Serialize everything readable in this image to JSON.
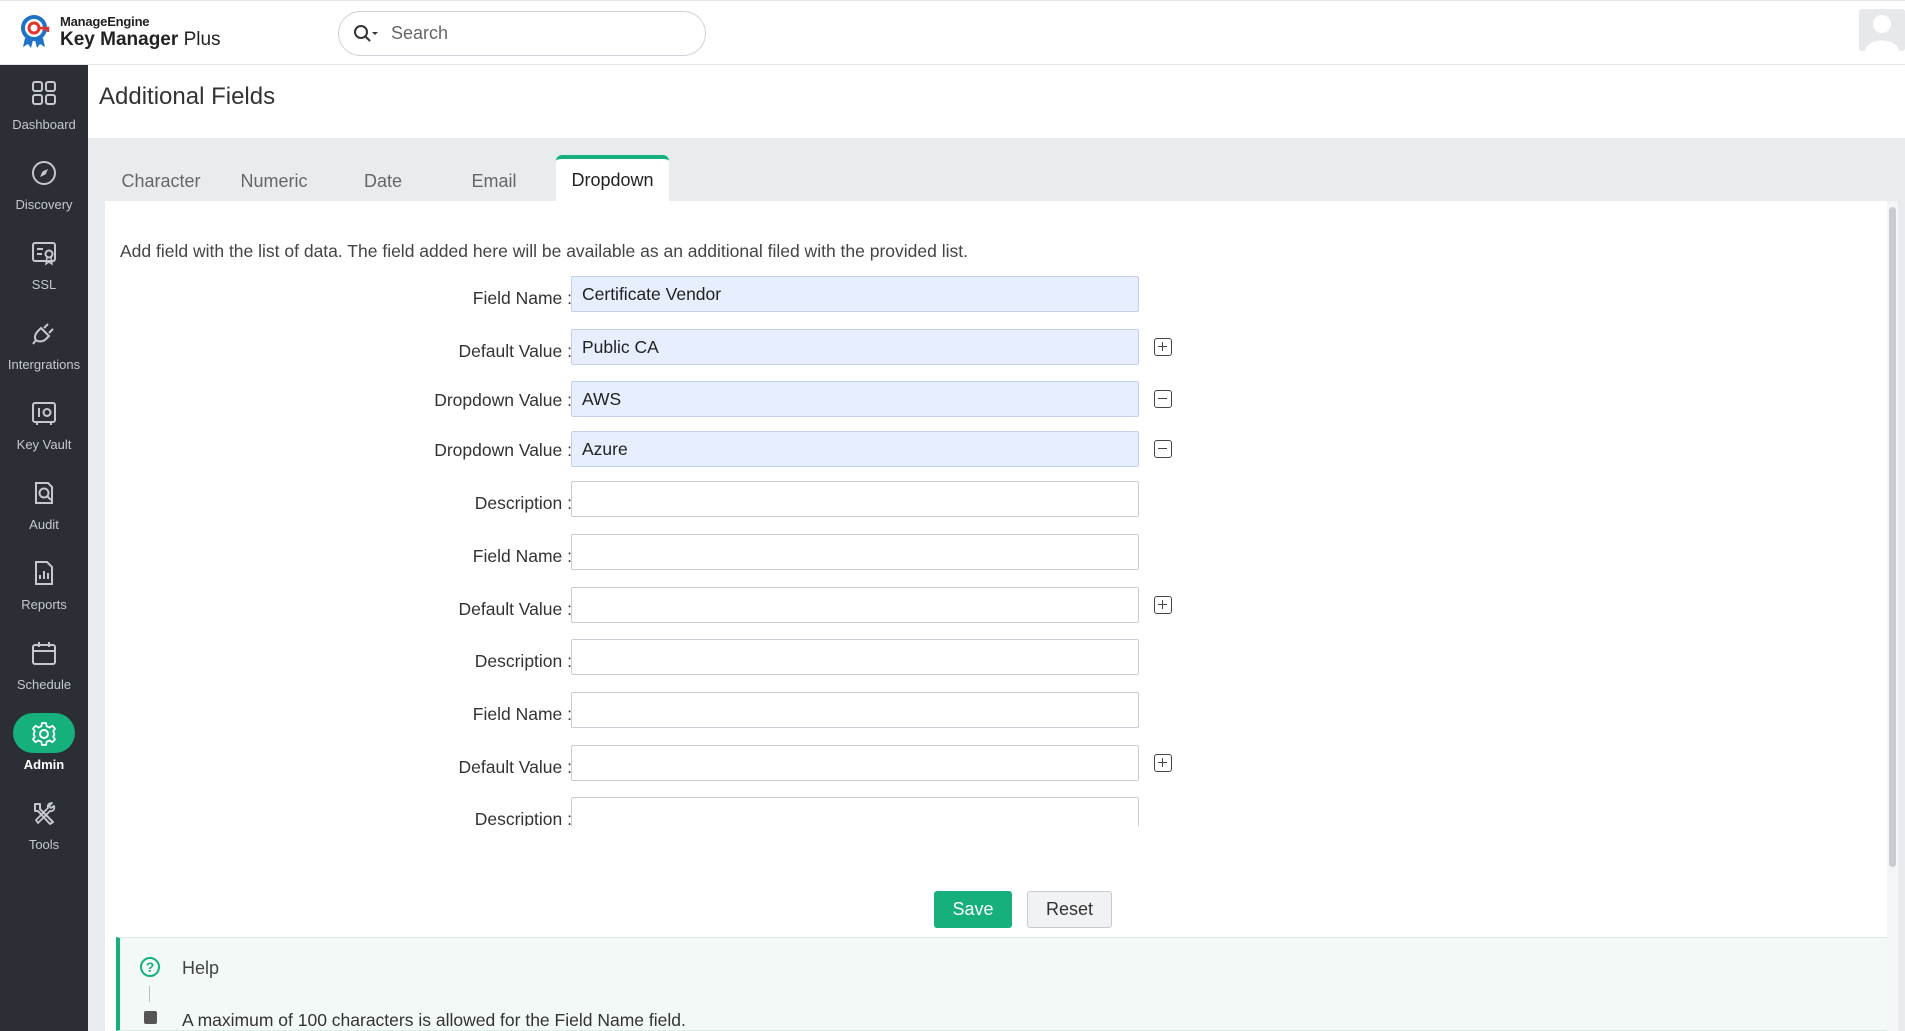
{
  "app": {
    "brand_top": "ManageEngine",
    "brand_name": "Key Manager",
    "brand_suffix": "Plus"
  },
  "search": {
    "placeholder": "Search"
  },
  "sidebar": {
    "items": [
      {
        "label": "Dashboard",
        "icon": "dashboard-icon",
        "active": false
      },
      {
        "label": "Discovery",
        "icon": "compass-icon",
        "active": false
      },
      {
        "label": "SSL",
        "icon": "certificate-icon",
        "active": false
      },
      {
        "label": "Intergrations",
        "icon": "plug-icon",
        "active": false
      },
      {
        "label": "Key Vault",
        "icon": "vault-icon",
        "active": false
      },
      {
        "label": "Audit",
        "icon": "audit-icon",
        "active": false
      },
      {
        "label": "Reports",
        "icon": "reports-icon",
        "active": false
      },
      {
        "label": "Schedule",
        "icon": "calendar-icon",
        "active": false
      },
      {
        "label": "Admin",
        "icon": "gear-icon",
        "active": true
      },
      {
        "label": "Tools",
        "icon": "tools-icon",
        "active": false
      }
    ],
    "accent": "#16b07c"
  },
  "page": {
    "title": "Additional Fields"
  },
  "tabs": [
    {
      "label": "Character",
      "active": false
    },
    {
      "label": "Numeric",
      "active": false
    },
    {
      "label": "Date",
      "active": false
    },
    {
      "label": "Email",
      "active": false
    },
    {
      "label": "Dropdown",
      "active": true
    }
  ],
  "form": {
    "intro": "Add field with the list of data. The field added here will be available as an additional filed with the provided list.",
    "rows": [
      {
        "label": "Field Name :",
        "value": "Certificate Vendor",
        "filled": true,
        "action": null
      },
      {
        "label": "Default Value :",
        "value": "Public CA",
        "filled": true,
        "action": "add"
      },
      {
        "label": "Dropdown Value :",
        "value": "AWS",
        "filled": true,
        "action": "remove"
      },
      {
        "label": "Dropdown Value :",
        "value": "Azure",
        "filled": true,
        "action": "remove"
      },
      {
        "label": "Description :",
        "value": "",
        "filled": false,
        "action": null
      },
      {
        "label": "Field Name :",
        "value": "",
        "filled": false,
        "action": null
      },
      {
        "label": "Default Value :",
        "value": "",
        "filled": false,
        "action": "add"
      },
      {
        "label": "Description :",
        "value": "",
        "filled": false,
        "action": null
      },
      {
        "label": "Field Name :",
        "value": "",
        "filled": false,
        "action": null
      },
      {
        "label": "Default Value :",
        "value": "",
        "filled": false,
        "action": "add"
      },
      {
        "label": "Description :",
        "value": "",
        "filled": false,
        "action": null
      },
      {
        "label": "",
        "value": "",
        "filled": false,
        "action": null
      }
    ],
    "save_label": "Save",
    "reset_label": "Reset"
  },
  "help": {
    "title": "Help",
    "items": [
      "A maximum of 100 characters is allowed for the Field Name field."
    ]
  }
}
